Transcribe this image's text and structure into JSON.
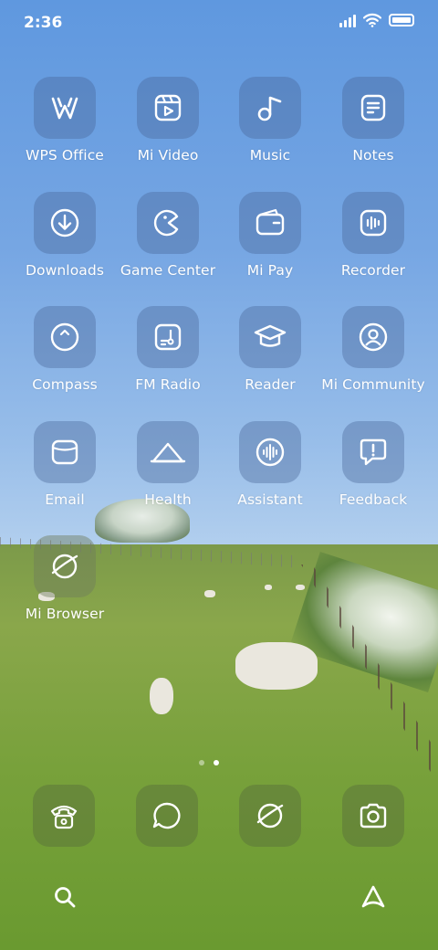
{
  "status_bar": {
    "time": "2:36",
    "signal_icon": "cellular-signal-icon",
    "wifi_icon": "wifi-icon",
    "battery_icon": "battery-icon"
  },
  "apps": [
    {
      "label": "WPS Office",
      "icon": "wps-office-icon"
    },
    {
      "label": "Mi Video",
      "icon": "video-play-icon"
    },
    {
      "label": "Music",
      "icon": "music-note-icon"
    },
    {
      "label": "Notes",
      "icon": "notes-icon"
    },
    {
      "label": "Downloads",
      "icon": "download-icon"
    },
    {
      "label": "Game Center",
      "icon": "game-pacman-icon"
    },
    {
      "label": "Mi Pay",
      "icon": "wallet-icon"
    },
    {
      "label": "Recorder",
      "icon": "waveform-icon"
    },
    {
      "label": "Compass",
      "icon": "compass-icon"
    },
    {
      "label": "FM Radio",
      "icon": "radio-icon"
    },
    {
      "label": "Reader",
      "icon": "graduation-cap-icon"
    },
    {
      "label": "Mi Community",
      "icon": "community-user-icon"
    },
    {
      "label": "Email",
      "icon": "email-icon"
    },
    {
      "label": "Health",
      "icon": "health-icon"
    },
    {
      "label": "Assistant",
      "icon": "assistant-voice-icon"
    },
    {
      "label": "Feedback",
      "icon": "feedback-icon"
    },
    {
      "label": "Mi Browser",
      "icon": "browser-planet-icon"
    }
  ],
  "page_indicator": {
    "pages": 2,
    "current": 2
  },
  "dock": [
    {
      "icon": "phone-icon"
    },
    {
      "icon": "messages-icon"
    },
    {
      "icon": "browser-planet-icon"
    },
    {
      "icon": "camera-icon"
    }
  ],
  "bottom_bar": [
    {
      "icon": "search-icon"
    },
    {
      "icon": "app-vault-icon"
    }
  ]
}
